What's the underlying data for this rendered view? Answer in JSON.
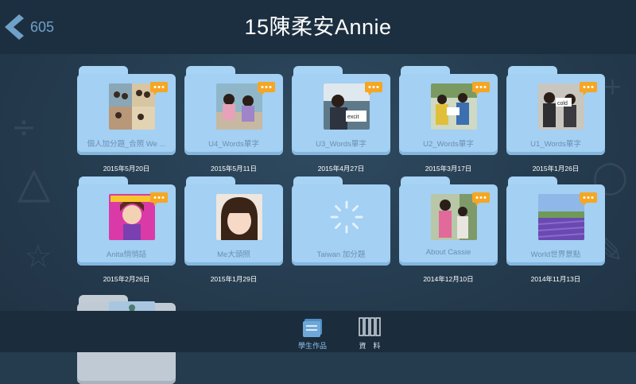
{
  "header": {
    "back_label": "605",
    "title": "15陳柔安Annie"
  },
  "folders": [
    {
      "label": "個人加分題_合照 We ...",
      "date": "2015年5月20日",
      "thumb": "group-photo",
      "has_comment": true
    },
    {
      "label": "U4_Words單字",
      "date": "2015年5月11日",
      "thumb": "two-girls-classroom",
      "has_comment": true
    },
    {
      "label": "U3_Words單字",
      "date": "2015年4月27日",
      "thumb": "girl-word-card",
      "has_comment": true
    },
    {
      "label": "U2_Words單字",
      "date": "2015年3月17日",
      "thumb": "kids-word-cards",
      "has_comment": true
    },
    {
      "label": "U1_Words單字",
      "date": "2015年1月26日",
      "thumb": "girls-cold-card",
      "has_comment": true
    },
    {
      "label": "Anita悄悄話",
      "date": "2015年2月26日",
      "thumb": "cartoon-girl",
      "has_comment": true
    },
    {
      "label": "Me大頭照",
      "date": "2015年1月29日",
      "thumb": "selfie",
      "has_comment": false
    },
    {
      "label": "Taiwan 加分題",
      "date": "",
      "thumb": "loading-spinner",
      "has_comment": false
    },
    {
      "label": "About Cassie",
      "date": "2014年12月10日",
      "thumb": "two-girls-outdoor",
      "has_comment": true
    },
    {
      "label": "World世界景點",
      "date": "2014年11月13日",
      "thumb": "lavender-field",
      "has_comment": true
    },
    {
      "label": "",
      "date": "",
      "thumb": "statue-of-liberty",
      "has_comment": false
    }
  ],
  "bottom_nav": {
    "student_works_label": "學生作品",
    "data_label": "資　料"
  },
  "colors": {
    "header_bg": "#1c2f40",
    "folder_blue": "#a3d0f3",
    "accent_active": "#6fa8d8",
    "comment_orange": "#f5a623"
  }
}
